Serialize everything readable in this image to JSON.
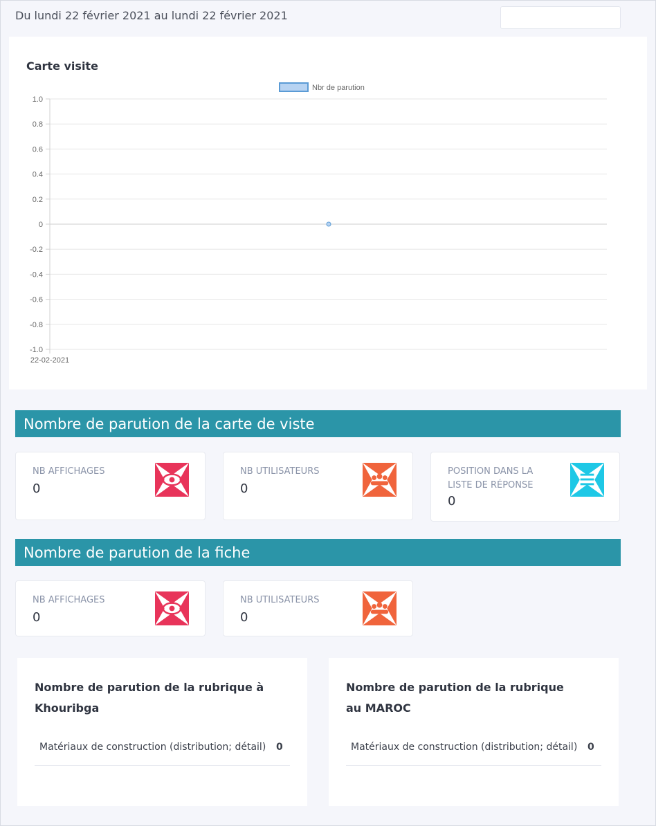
{
  "header": {
    "date_range": "Du lundi 22 février 2021 au lundi 22 février 2021"
  },
  "chart_card": {
    "title": "Carte visite"
  },
  "chart_data": {
    "type": "line",
    "title": "Carte visite",
    "x": [
      "22-02-2021"
    ],
    "series": [
      {
        "name": "Nbr de parution",
        "values": [
          0
        ]
      }
    ],
    "ylim": [
      -1.0,
      1.0
    ],
    "yticks": [
      "1.0",
      "0.8",
      "0.6",
      "0.4",
      "0.2",
      "0",
      "-0.2",
      "-0.4",
      "-0.6",
      "-0.8",
      "-1.0"
    ],
    "grid": true,
    "legend": "top-center",
    "colors": {
      "series": "#5b9bd5",
      "fill": "#b7d3f2"
    }
  },
  "section_carte": {
    "title": "Nombre de parution de la carte de viste",
    "stats": [
      {
        "label": "NB AFFICHAGES",
        "value": "0",
        "icon": "eye-icon",
        "color": "#e8345a"
      },
      {
        "label": "NB UTILISATEURS",
        "value": "0",
        "icon": "users-icon",
        "color": "#f0643c"
      },
      {
        "label": "POSITION DANS LA LISTE DE RÉPONSE",
        "value": "0",
        "icon": "list-icon",
        "color": "#1ec8e6"
      }
    ]
  },
  "section_fiche": {
    "title": "Nombre de parution de la fiche",
    "stats": [
      {
        "label": "NB AFFICHAGES",
        "value": "0",
        "icon": "eye-icon",
        "color": "#e8345a"
      },
      {
        "label": "NB UTILISATEURS",
        "value": "0",
        "icon": "users-icon",
        "color": "#f0643c"
      }
    ]
  },
  "rubriques": [
    {
      "title": "Nombre de parution de la rubrique à Khouribga",
      "rows": [
        {
          "label": "Matériaux de construction (distribution; détail)",
          "value": "0"
        }
      ]
    },
    {
      "title": "Nombre de parution de la rubrique au MAROC",
      "rows": [
        {
          "label": "Matériaux de construction (distribution; détail)",
          "value": "0"
        }
      ]
    }
  ]
}
